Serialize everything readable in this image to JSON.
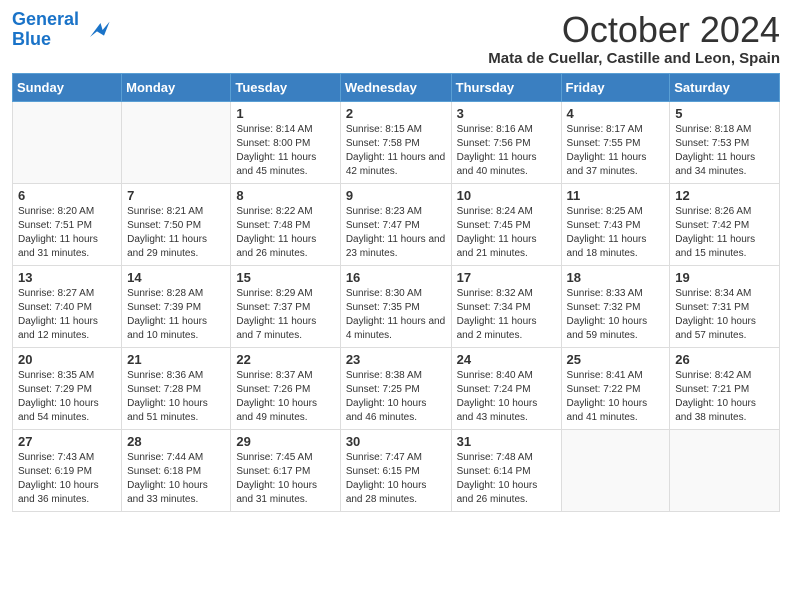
{
  "header": {
    "logo_line1": "General",
    "logo_line2": "Blue",
    "month": "October 2024",
    "location": "Mata de Cuellar, Castille and Leon, Spain"
  },
  "days_of_week": [
    "Sunday",
    "Monday",
    "Tuesday",
    "Wednesday",
    "Thursday",
    "Friday",
    "Saturday"
  ],
  "weeks": [
    [
      {
        "day": "",
        "info": ""
      },
      {
        "day": "",
        "info": ""
      },
      {
        "day": "1",
        "info": "Sunrise: 8:14 AM\nSunset: 8:00 PM\nDaylight: 11 hours and 45 minutes."
      },
      {
        "day": "2",
        "info": "Sunrise: 8:15 AM\nSunset: 7:58 PM\nDaylight: 11 hours and 42 minutes."
      },
      {
        "day": "3",
        "info": "Sunrise: 8:16 AM\nSunset: 7:56 PM\nDaylight: 11 hours and 40 minutes."
      },
      {
        "day": "4",
        "info": "Sunrise: 8:17 AM\nSunset: 7:55 PM\nDaylight: 11 hours and 37 minutes."
      },
      {
        "day": "5",
        "info": "Sunrise: 8:18 AM\nSunset: 7:53 PM\nDaylight: 11 hours and 34 minutes."
      }
    ],
    [
      {
        "day": "6",
        "info": "Sunrise: 8:20 AM\nSunset: 7:51 PM\nDaylight: 11 hours and 31 minutes."
      },
      {
        "day": "7",
        "info": "Sunrise: 8:21 AM\nSunset: 7:50 PM\nDaylight: 11 hours and 29 minutes."
      },
      {
        "day": "8",
        "info": "Sunrise: 8:22 AM\nSunset: 7:48 PM\nDaylight: 11 hours and 26 minutes."
      },
      {
        "day": "9",
        "info": "Sunrise: 8:23 AM\nSunset: 7:47 PM\nDaylight: 11 hours and 23 minutes."
      },
      {
        "day": "10",
        "info": "Sunrise: 8:24 AM\nSunset: 7:45 PM\nDaylight: 11 hours and 21 minutes."
      },
      {
        "day": "11",
        "info": "Sunrise: 8:25 AM\nSunset: 7:43 PM\nDaylight: 11 hours and 18 minutes."
      },
      {
        "day": "12",
        "info": "Sunrise: 8:26 AM\nSunset: 7:42 PM\nDaylight: 11 hours and 15 minutes."
      }
    ],
    [
      {
        "day": "13",
        "info": "Sunrise: 8:27 AM\nSunset: 7:40 PM\nDaylight: 11 hours and 12 minutes."
      },
      {
        "day": "14",
        "info": "Sunrise: 8:28 AM\nSunset: 7:39 PM\nDaylight: 11 hours and 10 minutes."
      },
      {
        "day": "15",
        "info": "Sunrise: 8:29 AM\nSunset: 7:37 PM\nDaylight: 11 hours and 7 minutes."
      },
      {
        "day": "16",
        "info": "Sunrise: 8:30 AM\nSunset: 7:35 PM\nDaylight: 11 hours and 4 minutes."
      },
      {
        "day": "17",
        "info": "Sunrise: 8:32 AM\nSunset: 7:34 PM\nDaylight: 11 hours and 2 minutes."
      },
      {
        "day": "18",
        "info": "Sunrise: 8:33 AM\nSunset: 7:32 PM\nDaylight: 10 hours and 59 minutes."
      },
      {
        "day": "19",
        "info": "Sunrise: 8:34 AM\nSunset: 7:31 PM\nDaylight: 10 hours and 57 minutes."
      }
    ],
    [
      {
        "day": "20",
        "info": "Sunrise: 8:35 AM\nSunset: 7:29 PM\nDaylight: 10 hours and 54 minutes."
      },
      {
        "day": "21",
        "info": "Sunrise: 8:36 AM\nSunset: 7:28 PM\nDaylight: 10 hours and 51 minutes."
      },
      {
        "day": "22",
        "info": "Sunrise: 8:37 AM\nSunset: 7:26 PM\nDaylight: 10 hours and 49 minutes."
      },
      {
        "day": "23",
        "info": "Sunrise: 8:38 AM\nSunset: 7:25 PM\nDaylight: 10 hours and 46 minutes."
      },
      {
        "day": "24",
        "info": "Sunrise: 8:40 AM\nSunset: 7:24 PM\nDaylight: 10 hours and 43 minutes."
      },
      {
        "day": "25",
        "info": "Sunrise: 8:41 AM\nSunset: 7:22 PM\nDaylight: 10 hours and 41 minutes."
      },
      {
        "day": "26",
        "info": "Sunrise: 8:42 AM\nSunset: 7:21 PM\nDaylight: 10 hours and 38 minutes."
      }
    ],
    [
      {
        "day": "27",
        "info": "Sunrise: 7:43 AM\nSunset: 6:19 PM\nDaylight: 10 hours and 36 minutes."
      },
      {
        "day": "28",
        "info": "Sunrise: 7:44 AM\nSunset: 6:18 PM\nDaylight: 10 hours and 33 minutes."
      },
      {
        "day": "29",
        "info": "Sunrise: 7:45 AM\nSunset: 6:17 PM\nDaylight: 10 hours and 31 minutes."
      },
      {
        "day": "30",
        "info": "Sunrise: 7:47 AM\nSunset: 6:15 PM\nDaylight: 10 hours and 28 minutes."
      },
      {
        "day": "31",
        "info": "Sunrise: 7:48 AM\nSunset: 6:14 PM\nDaylight: 10 hours and 26 minutes."
      },
      {
        "day": "",
        "info": ""
      },
      {
        "day": "",
        "info": ""
      }
    ]
  ]
}
